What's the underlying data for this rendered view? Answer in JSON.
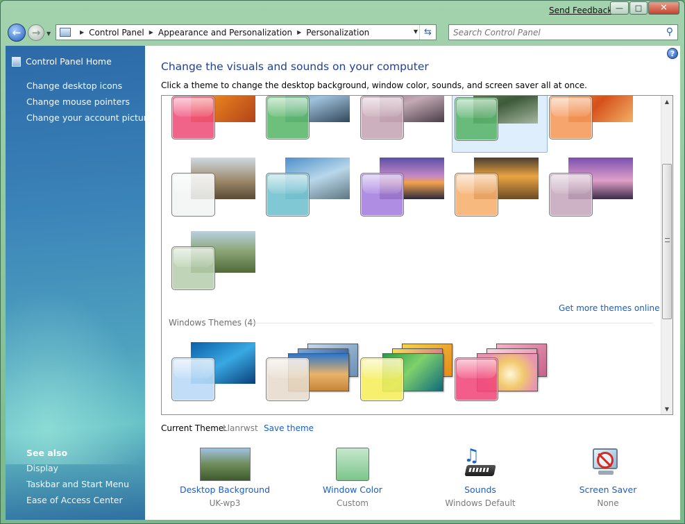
{
  "titlebar": {
    "send_feedback": "Send Feedback",
    "minimize": "—",
    "maximize": "□",
    "close": "✕"
  },
  "nav": {
    "breadcrumbs": [
      "Control Panel",
      "Appearance and Personalization",
      "Personalization"
    ],
    "search_placeholder": "Search Control Panel"
  },
  "sidebar": {
    "home": "Control Panel Home",
    "links": [
      "Change desktop icons",
      "Change mouse pointers",
      "Change your account picture"
    ],
    "see_also_title": "See also",
    "see_also": [
      "Display",
      "Taskbar and Start Menu",
      "Ease of Access Center"
    ]
  },
  "main": {
    "help": "?",
    "heading": "Change the visuals and sounds on your computer",
    "subheading": "Click a theme to change the desktop background, window color, sounds, and screen saver all at once.",
    "get_more": "Get more themes online",
    "windows_themes_label": "Windows Themes (4)",
    "current_theme_label": "Current Theme:",
    "current_theme_name": "Llanrwst",
    "save_theme": "Save theme"
  },
  "bottom": {
    "desktop_background": {
      "title": "Desktop Background",
      "value": "UK-wp3"
    },
    "window_color": {
      "title": "Window Color",
      "value": "Custom"
    },
    "sounds": {
      "title": "Sounds",
      "value": "Windows Default"
    },
    "screen_saver": {
      "title": "Screen Saver",
      "value": "None"
    }
  },
  "colors": {
    "link": "#1660c4",
    "heading": "#1e3f9c",
    "selected_theme_bg": "#dfeefc"
  }
}
